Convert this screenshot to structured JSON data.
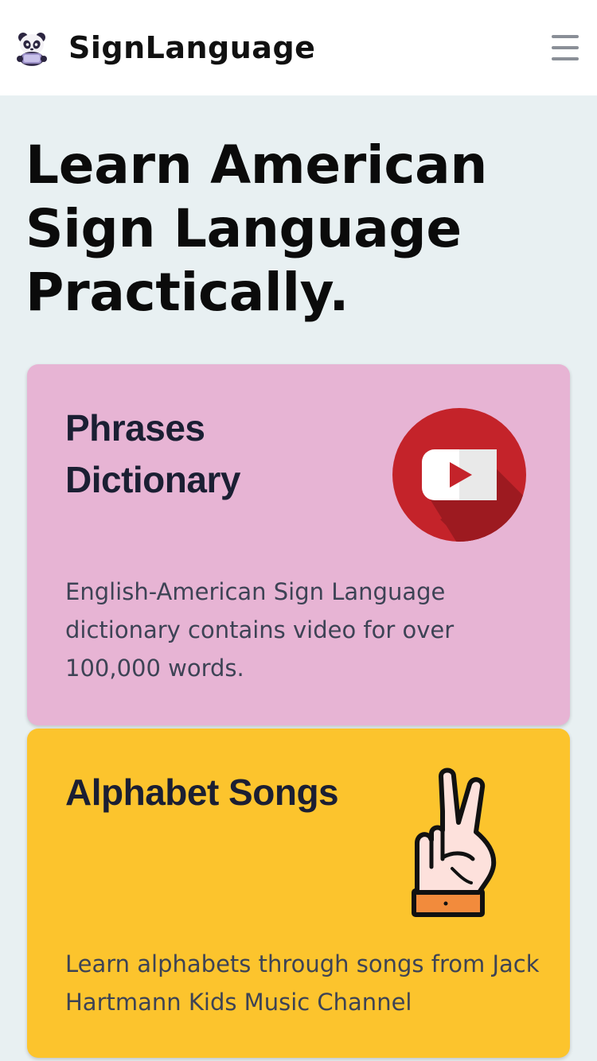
{
  "header": {
    "brand": "SignLanguage",
    "logo_icon": "panda-logo-icon",
    "menu_icon": "hamburger-menu-icon"
  },
  "hero": {
    "title": "Learn American Sign Language Practically."
  },
  "cards": [
    {
      "title": "Phrases Dictionary",
      "description": "English-American Sign Language dictionary contains video for over 100,000 words.",
      "icon": "youtube-play-icon",
      "background": "#e7b4d4"
    },
    {
      "title": "Alphabet Songs",
      "description": "Learn alphabets through songs from Jack Hartmann Kids Music Channel",
      "icon": "peace-hand-sign-icon",
      "background": "#fcc42d"
    }
  ],
  "colors": {
    "page_background": "#e8f0f2",
    "header_background": "#ffffff",
    "title_text": "#1b1f33",
    "body_text": "#3d4355",
    "youtube_red": "#c4232a"
  }
}
